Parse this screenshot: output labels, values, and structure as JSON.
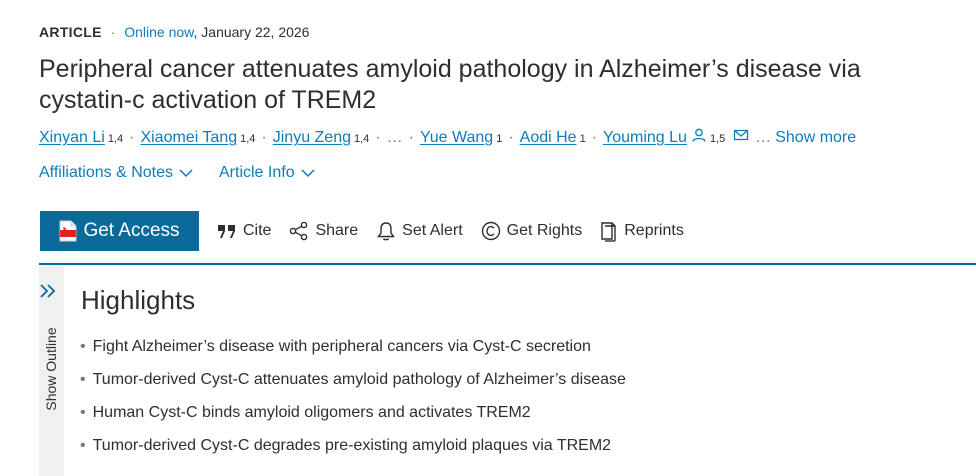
{
  "article": {
    "type": "ARTICLE",
    "separator": "·",
    "status": "Online now",
    "date": ", January 22, 2026",
    "title": "Peripheral cancer attenuates amyloid pathology in Alzheimer’s disease via cystatin-c activation of TREM2"
  },
  "authors": [
    {
      "name": "Xinyan Li",
      "affil": "1,4"
    },
    {
      "name": "Xiaomei Tang",
      "affil": "1,4"
    },
    {
      "name": "Jinyu Zeng",
      "affil": "1,4"
    },
    {
      "name": "Yue Wang",
      "affil": "1"
    },
    {
      "name": "Aodi He",
      "affil": "1"
    },
    {
      "name": "Youming Lu",
      "affil": "1,5"
    }
  ],
  "authors_ui": {
    "ellipsis": "…",
    "trailing_ellipsis": "…",
    "show_more": "Show more"
  },
  "links": {
    "affiliations": "Affiliations & Notes",
    "article_info": "Article Info"
  },
  "actions": {
    "get_access": "Get Access",
    "cite": "Cite",
    "share": "Share",
    "set_alert": "Set Alert",
    "get_rights": "Get Rights",
    "reprints": "Reprints"
  },
  "outline": {
    "label": "Show Outline"
  },
  "highlights": {
    "heading": "Highlights",
    "bullet": "•",
    "items": [
      "Fight Alzheimer’s disease with peripheral cancers via Cyst-C secretion",
      "Tumor-derived Cyst-C attenuates amyloid pathology of Alzheimer’s disease",
      "Human Cyst-C binds amyloid oligomers and activates TREM2",
      "Tumor-derived Cyst-C degrades pre-existing amyloid plaques via TREM2"
    ]
  },
  "colors": {
    "link": "#0c7dbb",
    "accent": "#0a6a9a",
    "pdf_red": "#e2231a"
  },
  "icons": [
    "user-icon",
    "mail-icon",
    "chevron-down-icon",
    "pdf-icon",
    "quote-icon",
    "share-icon",
    "bell-icon",
    "copyright-icon",
    "reprints-icon",
    "double-chevron-right-icon"
  ]
}
